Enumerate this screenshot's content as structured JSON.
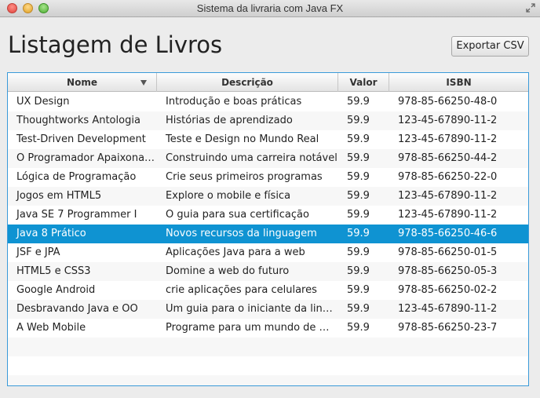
{
  "window": {
    "title": "Sistema da livraria com Java FX"
  },
  "page": {
    "title": "Listagem de Livros",
    "export_label": "Exportar CSV"
  },
  "table": {
    "columns": [
      "Nome",
      "Descrição",
      "Valor",
      "ISBN"
    ],
    "sort_column": "Nome",
    "selected_row": 7,
    "rows": [
      [
        "UX Design",
        "Introdução e boas práticas",
        "59.9",
        "978-85-66250-48-0"
      ],
      [
        "Thoughtworks Antologia",
        "Histórias de aprendizado",
        "59.9",
        "123-45-67890-11-2"
      ],
      [
        "Test-Driven Development",
        "Teste e Design no Mundo Real",
        "59.9",
        "123-45-67890-11-2"
      ],
      [
        "O Programador Apaixonado",
        "Construindo uma carreira notável",
        "59.9",
        "978-85-66250-44-2"
      ],
      [
        "Lógica de Programação",
        "Crie seus primeiros programas",
        "59.9",
        "978-85-66250-22-0"
      ],
      [
        "Jogos em HTML5",
        "Explore o mobile e física",
        "59.9",
        "123-45-67890-11-2"
      ],
      [
        "Java SE 7 Programmer I",
        "O guia para sua certificação",
        "59.9",
        "123-45-67890-11-2"
      ],
      [
        "Java 8 Prático",
        "Novos recursos da linguagem",
        "59.9",
        "978-85-66250-46-6"
      ],
      [
        "JSF e JPA",
        "Aplicações Java para a web",
        "59.9",
        "978-85-66250-01-5"
      ],
      [
        "HTML5 e CSS3",
        "Domine a web do futuro",
        "59.9",
        "978-85-66250-05-3"
      ],
      [
        "Google Android",
        "crie aplicações para celulares",
        "59.9",
        "978-85-66250-02-2"
      ],
      [
        "Desbravando Java e OO",
        "Um guia para o iniciante da linguagem",
        "59.9",
        "123-45-67890-11-2"
      ],
      [
        "A Web Mobile",
        "Programe para um mundo de muitos dispositivos",
        "59.9",
        "978-85-66250-23-7"
      ]
    ]
  }
}
